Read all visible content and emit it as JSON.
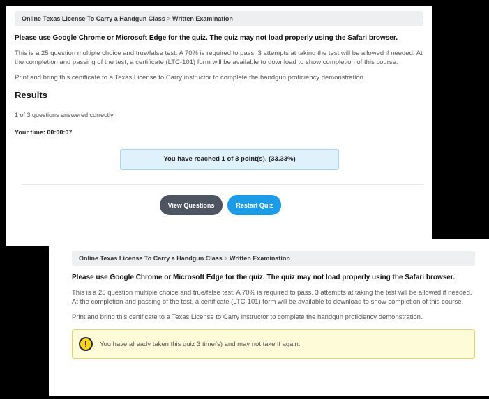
{
  "top": {
    "breadcrumb": {
      "course": "Online Texas License To Carry a Handgun Class",
      "separator": ">",
      "page": "Written Examination"
    },
    "browser_notice": "Please use Google Chrome or Microsoft Edge for the quiz. The quiz may not load properly using the Safari browser.",
    "description": "This is a 25 question multiple choice and true/false test. A 70% is required to pass. 3 attempts at taking the test will be allowed if needed. At the completion and passing of the test, a certificate (LTC-101) form will be available to download to show completion of this course.",
    "print_instruction": "Print and bring this certificate to a Texas License to Carry instructor to complete the handgun proficiency demonstration.",
    "results_title": "Results",
    "answered_text": "1 of 3 questions answered correctly",
    "time_label": "Your time:",
    "time_value": "00:00:07",
    "points_text": "You have reached 1 of 3 point(s), (33.33%)",
    "view_questions_label": "View Questions",
    "restart_quiz_label": "Restart Quiz"
  },
  "bottom": {
    "breadcrumb": {
      "course": "Online Texas License To Carry a Handgun Class",
      "separator": ">",
      "page": "Written Examination"
    },
    "browser_notice": "Please use Google Chrome or Microsoft Edge for the quiz. The quiz may not load properly using the Safari browser.",
    "description": "This is a 25 question multiple choice and true/false test. A 70% is required to pass. 3 attempts at taking the test will be allowed if needed. At the completion and passing of the test, a certificate (LTC-101) form will be available to download to show completion of this course.",
    "print_instruction": "Print and bring this certificate to a Texas License to Carry instructor to complete the handgun proficiency demonstration.",
    "warning_icon": "!",
    "warning_text": "You have already taken this quiz 3 time(s) and may not take it again."
  },
  "colors": {
    "accent_blue": "#1d9be6",
    "button_dark": "#4e5560",
    "info_bg": "#dff1fb",
    "warning_bg": "#fdfbd8",
    "warning_icon": "#f7d21a"
  }
}
